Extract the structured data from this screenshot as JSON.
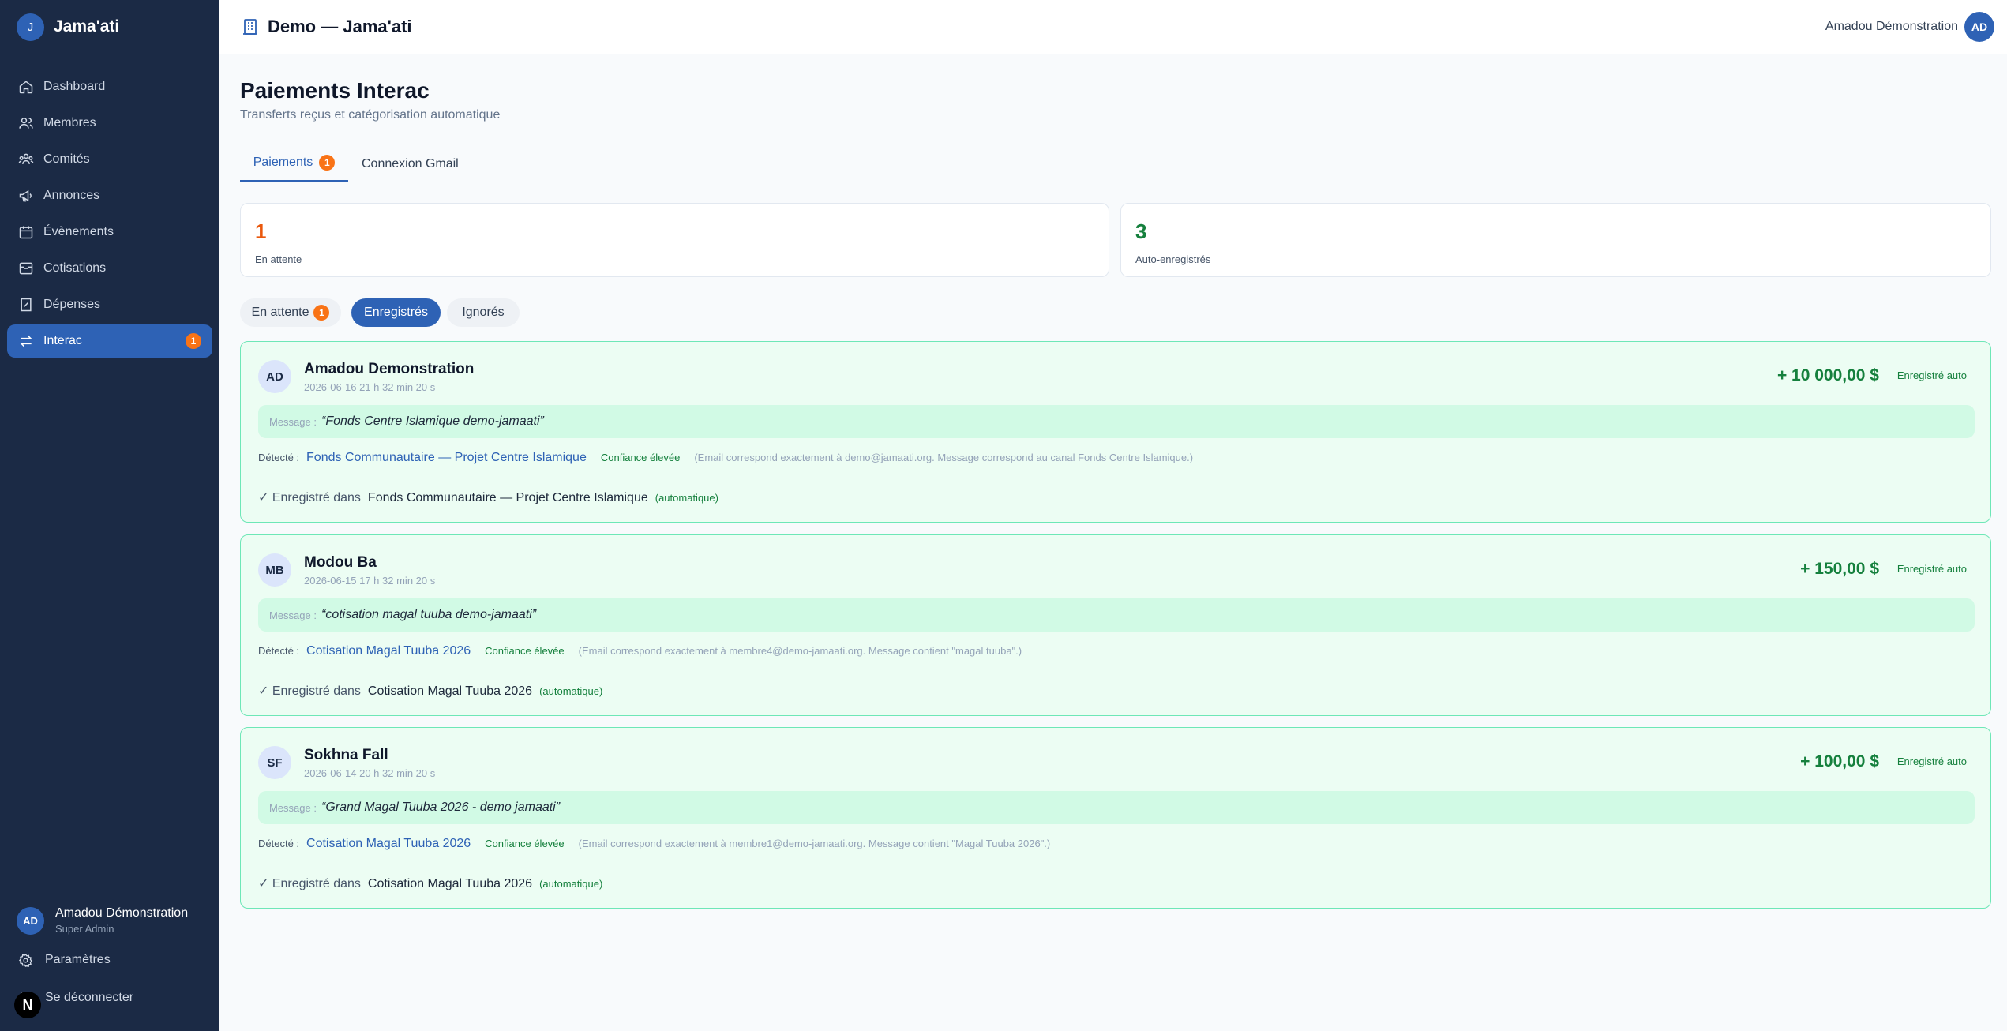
{
  "app": {
    "logo_letter": "J",
    "name": "Jama'ati"
  },
  "nav": [
    {
      "label": "Dashboard",
      "icon": "home-icon",
      "active": false
    },
    {
      "label": "Membres",
      "icon": "users-icon",
      "active": false
    },
    {
      "label": "Comités",
      "icon": "committees-icon",
      "active": false
    },
    {
      "label": "Annonces",
      "icon": "megaphone-icon",
      "active": false
    },
    {
      "label": "Évènements",
      "icon": "calendar-icon",
      "active": false
    },
    {
      "label": "Cotisations",
      "icon": "archive-icon",
      "active": false
    },
    {
      "label": "Dépenses",
      "icon": "receipt-icon",
      "active": false
    },
    {
      "label": "Interac",
      "icon": "transfer-icon",
      "active": true,
      "badge": "1"
    }
  ],
  "sidebar_user": {
    "initials": "AD",
    "name": "Amadou Démonstration",
    "role": "Super Admin"
  },
  "settings_label": "Paramètres",
  "logout_label": "Se déconnecter",
  "n_badge": "N",
  "topbar": {
    "title": "Demo — Jama'ati",
    "user_name": "Amadou Démonstration",
    "user_initials": "AD"
  },
  "page": {
    "title": "Paiements Interac",
    "subtitle": "Transferts reçus et catégorisation automatique"
  },
  "tabs": [
    {
      "label": "Paiements",
      "badge": "1",
      "active": true
    },
    {
      "label": "Connexion Gmail",
      "active": false
    }
  ],
  "stats": [
    {
      "value": "1",
      "label": "En attente",
      "color": "#ea580c"
    },
    {
      "value": "3",
      "label": "Auto-enregistrés",
      "color": "#15803d"
    }
  ],
  "filters": [
    {
      "label": "En attente",
      "badge": "1",
      "active": false
    },
    {
      "label": "Enregistrés",
      "active": true
    },
    {
      "label": "Ignorés",
      "active": false
    }
  ],
  "labels": {
    "message": "Message :",
    "detected": "Détecté :",
    "recorded_in": "✓ Enregistré dans",
    "auto": "(automatique)"
  },
  "payments": [
    {
      "initials": "AD",
      "name": "Amadou Demonstration",
      "date": "2026-06-16 21 h 32 min 20 s",
      "amount": "+ 10 000,00 $",
      "status": "Enregistré auto",
      "message": "“Fonds Centre Islamique demo-jamaati”",
      "detected_fund": "Fonds Communautaire — Projet Centre Islamique",
      "confidence": "Confiance élevée",
      "reason": "(Email correspond exactement à demo@jamaati.org. Message correspond au canal Fonds Centre Islamique.)",
      "recorded_fund": "Fonds Communautaire — Projet Centre Islamique"
    },
    {
      "initials": "MB",
      "name": "Modou Ba",
      "date": "2026-06-15 17 h 32 min 20 s",
      "amount": "+ 150,00 $",
      "status": "Enregistré auto",
      "message": "“cotisation magal tuuba demo-jamaati”",
      "detected_fund": "Cotisation Magal Tuuba 2026",
      "confidence": "Confiance élevée",
      "reason": "(Email correspond exactement à membre4@demo-jamaati.org. Message contient \"magal tuuba\".)",
      "recorded_fund": "Cotisation Magal Tuuba 2026"
    },
    {
      "initials": "SF",
      "name": "Sokhna Fall",
      "date": "2026-06-14 20 h 32 min 20 s",
      "amount": "+ 100,00 $",
      "status": "Enregistré auto",
      "message": "“Grand Magal Tuuba 2026 - demo jamaati”",
      "detected_fund": "Cotisation Magal Tuuba 2026",
      "confidence": "Confiance élevée",
      "reason": "(Email correspond exactement à membre1@demo-jamaati.org. Message contient \"Magal Tuuba 2026\".)",
      "recorded_fund": "Cotisation Magal Tuuba 2026"
    }
  ]
}
